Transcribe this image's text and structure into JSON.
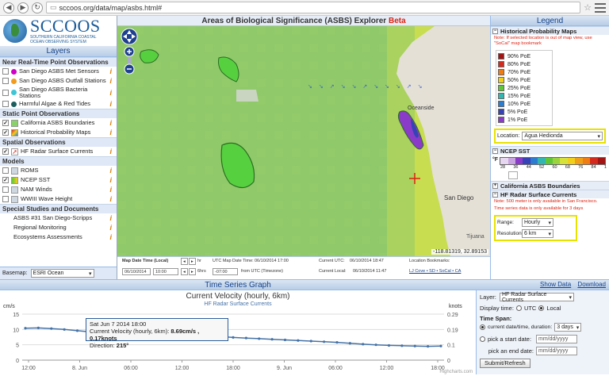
{
  "browser": {
    "url": "sccoos.org/data/map/asbs.html#"
  },
  "logo": {
    "name": "SCCOOS",
    "subtitle": "SOUTHERN CALIFORNIA COASTAL OCEAN OBSERVING SYSTEM"
  },
  "layers": {
    "title": "Layers",
    "sections": {
      "realtime": "Near Real-Time Point Observations",
      "static": "Static Point Observations",
      "spatial": "Spatial Observations",
      "models": "Models",
      "special": "Special Studies and Documents"
    },
    "items": {
      "met": "San Diego ASBS Met Sensors",
      "outfall": "San Diego ASBS Outfall Stations",
      "bacteria": "San Diego ASBS Bacteria Stations",
      "hab": "Harmful Algae & Red Tides",
      "boundaries": "California ASBS Boundaries",
      "hpm": "Historical Probability Maps",
      "hfradar": "HF Radar Surface Currents",
      "roms": "ROMS",
      "ncep": "NCEP SST",
      "nam": "NAM Winds",
      "wwiii": "WWIII Wave Height",
      "asbs31": "ASBS #31 San Diego-Scripps",
      "regional": "Regional Monitoring",
      "eco": "Ecosystems Assessments"
    },
    "basemap_label": "Basemap:",
    "basemap_value": "ESRI Ocean"
  },
  "map": {
    "title": "Areas of Biological Significance (ASBS) Explorer",
    "beta": "Beta",
    "coords": "-118.81319, 32.89153",
    "labels": {
      "oceanside": "Oceanside",
      "sandiego": "San Diego",
      "tijuana": "Tijuana"
    },
    "info": {
      "date_label": "Map Date Time (Local)",
      "hr": "hr",
      "hrs": "6hrs",
      "date": "06/10/2014",
      "time": "10:00",
      "utc_label": "UTC Map Date Time:",
      "utc_value": "06/10/2014 17:00",
      "offset": "-07:00",
      "offset_label": "from UTC (Timezone)",
      "current_utc_label": "Current UTC:",
      "current_utc": "06/10/2014 18:47",
      "current_local_label": "Current Local:",
      "current_local": "06/10/2014 11:47",
      "bookmarks_label": "Location Bookmarks:",
      "bookmarks": "LJ Cove • SD • SoCal • CA"
    }
  },
  "legend": {
    "title": "Legend",
    "hpm": "Historical Probability Maps",
    "hpm_note": "Note: If selected location is out of map view, use \"SoCal\" map bookmark",
    "poe": [
      {
        "label": "90% PoE",
        "color": "#a31515"
      },
      {
        "label": "80% PoE",
        "color": "#d42a1e"
      },
      {
        "label": "70% PoE",
        "color": "#f07c14"
      },
      {
        "label": "50% PoE",
        "color": "#f2cf1b"
      },
      {
        "label": "25% PoE",
        "color": "#5fc638"
      },
      {
        "label": "15% PoE",
        "color": "#33b6b0"
      },
      {
        "label": "10% PoE",
        "color": "#2c7cd0"
      },
      {
        "label": "5% PoE",
        "color": "#3642b5"
      },
      {
        "label": "1% PoE",
        "color": "#8a3cc8"
      }
    ],
    "location_label": "Location:",
    "location_value": "Agua Hedionda",
    "ncep": "NCEP SST",
    "unit": "°F",
    "ticks": [
      "28",
      "36",
      "44",
      "52",
      "60",
      "68",
      "76",
      "84",
      "1"
    ],
    "ca_boundaries": "California ASBS Boundaries",
    "hfradar": "HF Radar Surface Currents",
    "hf_note": "Note: 500 meter is only available in San Francisco.",
    "hf_note2": "Time series data is only available for 3 days",
    "range_label": "Range:",
    "range_value": "Hourly",
    "res_label": "Resolution:",
    "res_value": "6 km"
  },
  "timeseries": {
    "bar_title": "Time Series Graph",
    "show_data": "Show Data",
    "download": "Download",
    "credit": "Highcharts.com",
    "tooltip": {
      "date": "Sat Jun 7 2014 18:00",
      "label": "Current Velocity (hourly, 6km):",
      "value": "8.69cm/s , 0.17knots",
      "dir_label": "Direction:",
      "dir_value": "215°"
    },
    "controls": {
      "layer_label": "Layer:",
      "layer_value": "HF Radar Surface Currents",
      "display_label": "Display time:",
      "utc": "UTC",
      "local": "Local",
      "span_label": "Time Span:",
      "current_opt": "current date/time, duration:",
      "duration": "3 days",
      "start_opt": "pick a start date:",
      "end_label": "pick an end date:",
      "date_ph": "mm/dd/yyyy",
      "submit": "Submit/Refresh"
    }
  },
  "chart_data": {
    "type": "line",
    "title": "Current Velocity (hourly, 6km)",
    "subtitle": "HF Radar Surface Currents",
    "ylabel_left": "cm/s",
    "ylabel_right": "knots",
    "ylim": [
      0,
      15
    ],
    "ylim_right": [
      0,
      0.29
    ],
    "yticks": [
      "0",
      "5",
      "10",
      "15"
    ],
    "yticks_right": [
      "0",
      "0.1",
      "0.19",
      "0.29"
    ],
    "xticks": [
      "12:00",
      "8. Jun",
      "06:00",
      "12:00",
      "18:00",
      "9. Jun",
      "06:00",
      "12:00",
      "18:00"
    ],
    "grid": true,
    "series": [
      {
        "values": [
          10.4,
          10.5,
          10.3,
          10.0,
          9.6,
          9.2,
          8.9,
          8.7,
          8.6,
          8.6,
          8.5,
          8.4,
          8.2,
          8.1,
          7.9,
          7.7,
          7.4,
          7.2,
          7.0,
          6.8,
          6.6,
          6.4,
          6.2,
          6.0,
          5.8,
          5.5,
          5.2,
          5.0,
          4.8,
          4.7,
          4.6,
          4.5,
          4.6
        ]
      }
    ],
    "highlight_index": 6
  }
}
